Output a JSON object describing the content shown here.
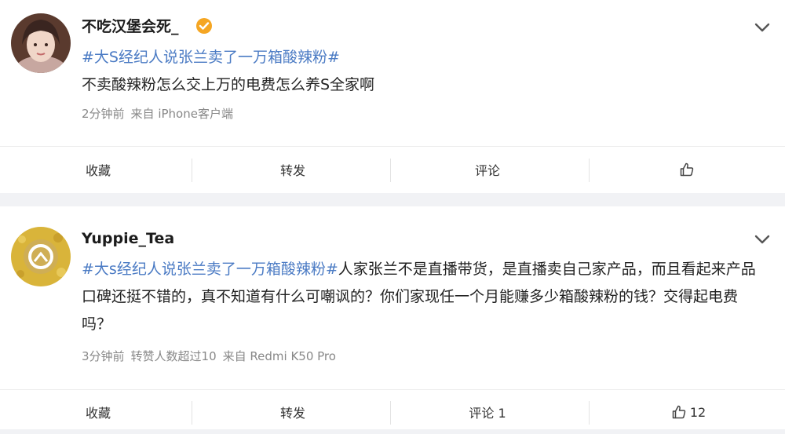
{
  "colors": {
    "hashtag": "#4b7bc4",
    "verified_badge": "#f5a623",
    "background": "#f1f2f5"
  },
  "posts": [
    {
      "username": "不吃汉堡会死_",
      "verified": true,
      "hashtag": "#大S经纪人说张兰卖了一万箱酸辣粉#",
      "text": "不卖酸辣粉怎么交上万的电费怎么养S全家啊",
      "meta": {
        "time": "2分钟前",
        "forwarded": "",
        "source": "来自 iPhone客户端"
      },
      "actions": {
        "collect": "收藏",
        "repost": "转发",
        "comment": "评论",
        "like_count": ""
      },
      "icons": [
        "avatar",
        "verified-badge-icon",
        "chevron-down-icon",
        "thumbs-up-icon"
      ]
    },
    {
      "username": "Yuppie_Tea",
      "verified": false,
      "hashtag": "#大s经纪人说张兰卖了一万箱酸辣粉#",
      "text": "人家张兰不是直播带货，是直播卖自己家产品，而且看起来产品口碑还挺不错的，真不知道有什么可嘲讽的？你们家现任一个月能赚多少箱酸辣粉的钱？交得起电费吗？",
      "meta": {
        "time": "3分钟前",
        "forwarded": "转赞人数超过10",
        "source": "来自 Redmi K50 Pro"
      },
      "actions": {
        "collect": "收藏",
        "repost": "转发",
        "comment": "评论 1",
        "like_count": "12"
      },
      "icons": [
        "avatar",
        "chevron-down-icon",
        "thumbs-up-icon"
      ]
    }
  ]
}
